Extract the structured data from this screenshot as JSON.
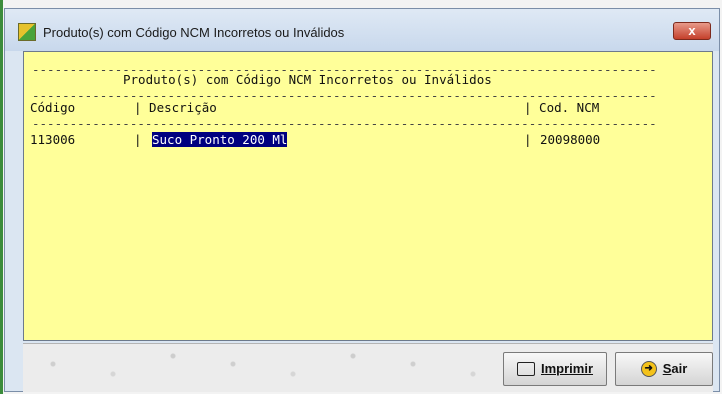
{
  "window": {
    "title": "Produto(s) com Código NCM Incorretos ou Inválidos",
    "close_label": "x"
  },
  "report": {
    "separator": "-----------------------------------------------------------------------------------",
    "heading": "Produto(s) com Código NCM Incorretos ou Inválidos",
    "headers": {
      "codigo": "Código",
      "descricao": "| Descrição",
      "ncm": "| Cod. NCM"
    },
    "rows": [
      {
        "codigo": "113006",
        "sep1": "| ",
        "descricao": "Suco Pronto 200 Ml",
        "sep2": "| ",
        "ncm": "20098000"
      }
    ]
  },
  "buttons": {
    "print": {
      "prefix": "",
      "accel": "I",
      "rest": "mprimir"
    },
    "exit": {
      "accel": "S",
      "rest": "air"
    }
  },
  "colors": {
    "report_bg": "#ffff99",
    "selection": "#000080",
    "close_button": "#c4402b"
  },
  "icons": {
    "app": "app-icon",
    "print": "printer-icon",
    "exit": "exit-arrow-icon"
  }
}
